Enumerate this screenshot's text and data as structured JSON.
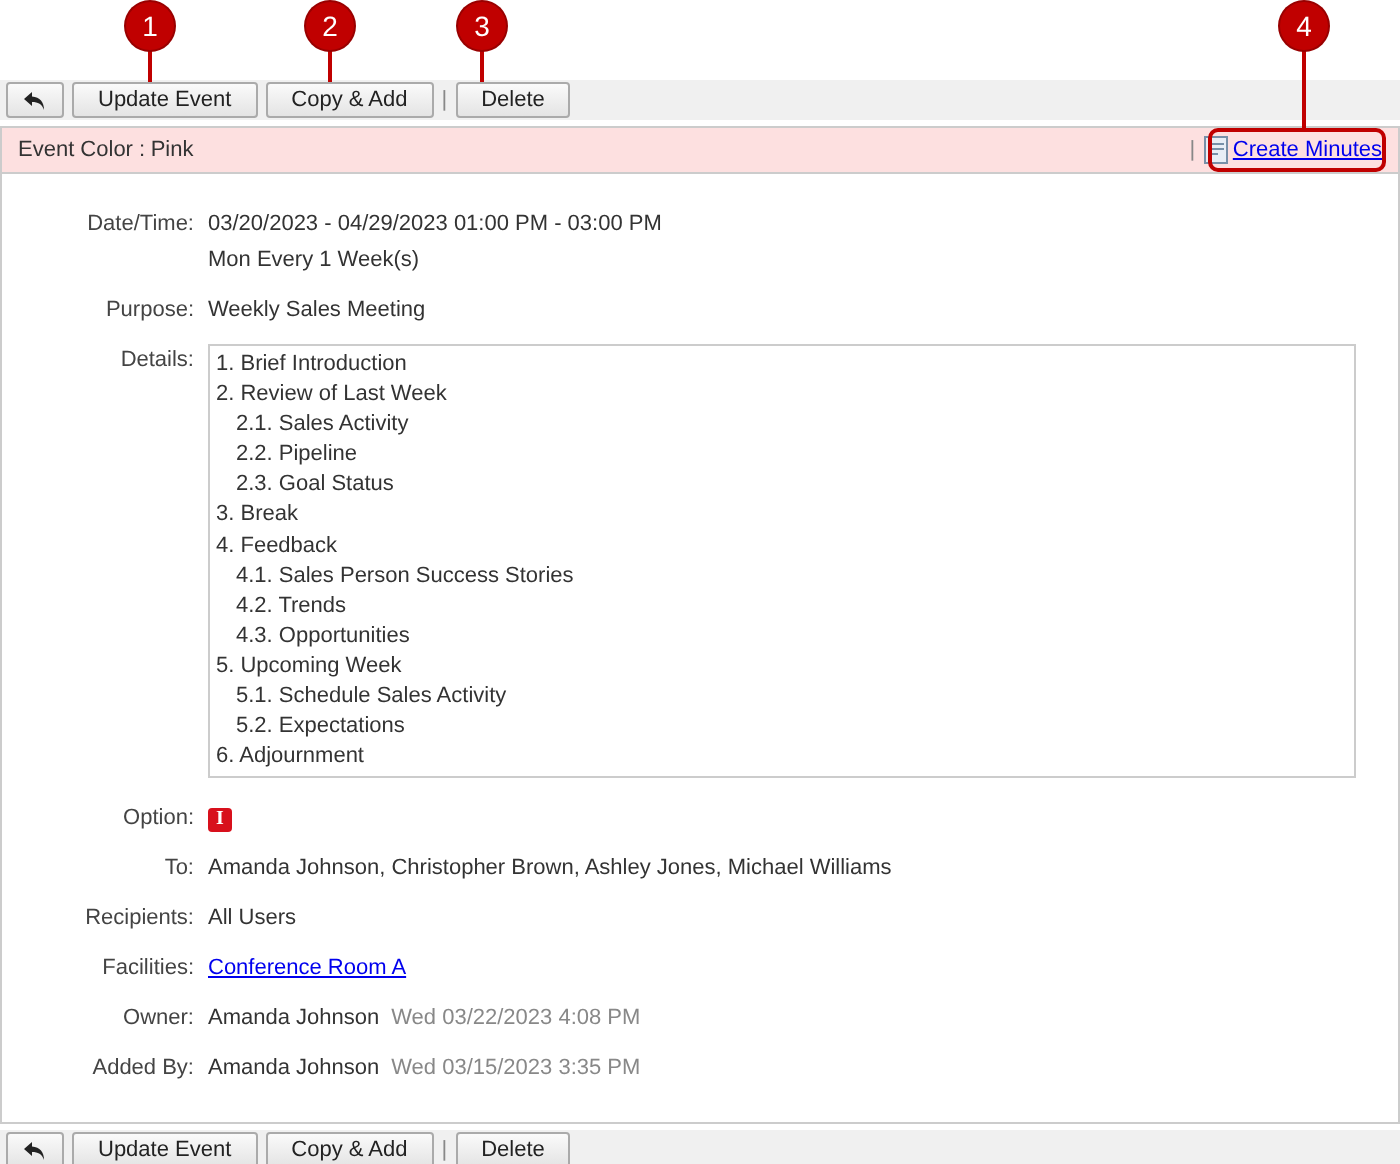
{
  "callouts": [
    "1",
    "2",
    "3",
    "4"
  ],
  "toolbar_top": {
    "buttons": [
      {
        "kind": "back"
      },
      {
        "kind": "text",
        "label": "Update Event"
      },
      {
        "kind": "text",
        "label": "Copy & Add"
      },
      {
        "kind": "separator",
        "label": "|"
      },
      {
        "kind": "text",
        "label": "Delete"
      }
    ]
  },
  "event_color": {
    "label": "Event Color :",
    "value": "Pink",
    "separator": "|",
    "action": "Create Minutes"
  },
  "fields": [
    {
      "kind": "lines",
      "label": "Date/Time:",
      "lines": [
        "03/20/2023 - 04/29/2023 01:00 PM - 03:00 PM",
        "Mon Every 1 Week(s)"
      ]
    },
    {
      "kind": "text",
      "label": "Purpose:",
      "value": "Weekly Sales Meeting"
    },
    {
      "kind": "details",
      "label": "Details:",
      "items": [
        {
          "text": "1. Brief Introduction"
        },
        {
          "text": "2. Review of Last Week",
          "children": [
            {
              "text": "2.1. Sales Activity"
            },
            {
              "text": "2.2. Pipeline"
            },
            {
              "text": "2.3. Goal Status"
            }
          ]
        },
        {
          "text": "3. Break"
        },
        {
          "text": "4. Feedback",
          "children": [
            {
              "text": "4.1. Sales Person Success Stories"
            },
            {
              "text": "4.2. Trends"
            },
            {
              "text": "4.3. Opportunities"
            }
          ]
        },
        {
          "text": "5. Upcoming Week",
          "children": [
            {
              "text": "5.1. Schedule Sales Activity"
            },
            {
              "text": "5.2. Expectations"
            }
          ]
        },
        {
          "text": "6. Adjournment"
        }
      ]
    },
    {
      "kind": "option",
      "label": "Option:",
      "value": "I"
    },
    {
      "kind": "text",
      "label": "To:",
      "value": "Amanda Johnson, Christopher Brown, Ashley Jones, Michael Williams"
    },
    {
      "kind": "text",
      "label": "Recipients:",
      "value": "All Users"
    },
    {
      "kind": "link",
      "label": "Facilities:",
      "value": "Conference Room A"
    },
    {
      "kind": "stamp",
      "label": "Owner:",
      "value": "Amanda Johnson",
      "time": "Wed 03/22/2023 4:08 PM"
    },
    {
      "kind": "stamp",
      "label": "Added By:",
      "value": "Amanda Johnson",
      "time": "Wed 03/15/2023 3:35 PM"
    }
  ],
  "toolbar_bottom": {
    "buttons": [
      {
        "kind": "back"
      },
      {
        "kind": "text",
        "label": "Update Event"
      },
      {
        "kind": "text",
        "label": "Copy & Add"
      },
      {
        "kind": "separator",
        "label": "|"
      },
      {
        "kind": "text",
        "label": "Delete"
      }
    ]
  }
}
